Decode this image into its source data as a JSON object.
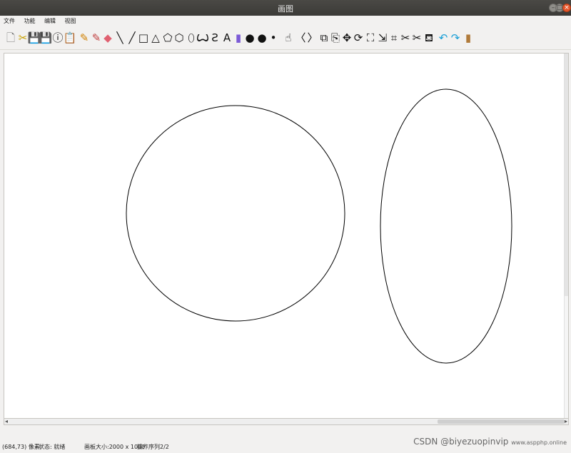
{
  "window": {
    "title": "画图"
  },
  "menu": {
    "items": [
      "文件",
      "功能",
      "编辑",
      "视图"
    ]
  },
  "toolbar": {
    "tools": [
      {
        "name": "new-file-icon",
        "glyph": "🗋",
        "color": "#7a7a7a"
      },
      {
        "name": "open-file-icon",
        "glyph": "✂",
        "color": "#c8a000"
      },
      {
        "name": "save-icon",
        "glyph": "💾",
        "color": "#4a5bd6"
      },
      {
        "name": "save-as-icon",
        "glyph": "💾",
        "color": "#7a3fa8"
      },
      {
        "name": "info-icon",
        "glyph": "ⓘ",
        "color": "#111111"
      },
      {
        "name": "clipboard-icon",
        "glyph": "📋",
        "color": "#e0b000"
      },
      {
        "name": "pencil-icon",
        "glyph": "✎",
        "color": "#d08000"
      },
      {
        "name": "brush-icon",
        "glyph": "✎",
        "color": "#c04040"
      },
      {
        "name": "eraser-icon",
        "glyph": "◆",
        "color": "#e06070"
      },
      {
        "name": "backslash-line-icon",
        "glyph": "╲",
        "color": "#111111"
      },
      {
        "name": "slash-line-icon",
        "glyph": "╱",
        "color": "#111111"
      },
      {
        "name": "rectangle-icon",
        "glyph": "□",
        "color": "#111111"
      },
      {
        "name": "triangle-icon",
        "glyph": "△",
        "color": "#111111"
      },
      {
        "name": "pentagon-icon",
        "glyph": "⬠",
        "color": "#111111"
      },
      {
        "name": "polygon-icon",
        "glyph": "⬡",
        "color": "#111111"
      },
      {
        "name": "ellipse-icon",
        "glyph": "⬯",
        "color": "#111111"
      },
      {
        "name": "curve-icon",
        "glyph": "Ꙍ",
        "color": "#111111"
      },
      {
        "name": "s-curve-icon",
        "glyph": "Ƨ",
        "color": "#111111"
      },
      {
        "name": "text-icon",
        "glyph": "A",
        "color": "#111111"
      },
      {
        "name": "color-palette-icon",
        "glyph": "▮",
        "color": "#7b5ad6"
      },
      {
        "name": "large-dot-icon",
        "glyph": "●",
        "color": "#111111"
      },
      {
        "name": "medium-dot-icon",
        "glyph": "●",
        "color": "#111111"
      },
      {
        "name": "small-dot-icon",
        "glyph": "•",
        "color": "#111111"
      },
      {
        "name": "pointer-icon",
        "glyph": "☝",
        "color": "#111111"
      },
      {
        "name": "chevron-left-icon",
        "glyph": "〈",
        "color": "#111111"
      },
      {
        "name": "chevron-right-icon",
        "glyph": "〉",
        "color": "#111111"
      },
      {
        "name": "copy-icon",
        "glyph": "⧉",
        "color": "#111111"
      },
      {
        "name": "paste-icon",
        "glyph": "⎘",
        "color": "#111111"
      },
      {
        "name": "move-icon",
        "glyph": "✥",
        "color": "#111111"
      },
      {
        "name": "rotate-icon",
        "glyph": "⟳",
        "color": "#111111"
      },
      {
        "name": "fullscreen-icon",
        "glyph": "⛶",
        "color": "#111111"
      },
      {
        "name": "resize-icon",
        "glyph": "⇲",
        "color": "#111111"
      },
      {
        "name": "crop-icon",
        "glyph": "⌗",
        "color": "#111111"
      },
      {
        "name": "cut-icon",
        "glyph": "✂",
        "color": "#111111"
      },
      {
        "name": "scissors-icon",
        "glyph": "✂",
        "color": "#111111"
      },
      {
        "name": "fill-bucket-icon",
        "glyph": "⛾",
        "color": "#111111"
      },
      {
        "name": "undo-icon",
        "glyph": "↶",
        "color": "#1a9fd6"
      },
      {
        "name": "redo-icon",
        "glyph": "↷",
        "color": "#1a9fd6"
      },
      {
        "name": "door-icon",
        "glyph": "▮",
        "color": "#b07a3a"
      }
    ]
  },
  "status": {
    "coords": "(684,73) 像素",
    "state": "状态: 就绪",
    "canvas_size": "画板大小:2000 x 1000",
    "operation": "操作序列2/2"
  },
  "watermark": "CSDN @biyezuopinvip",
  "watermark_small": "www.aspphp.online"
}
